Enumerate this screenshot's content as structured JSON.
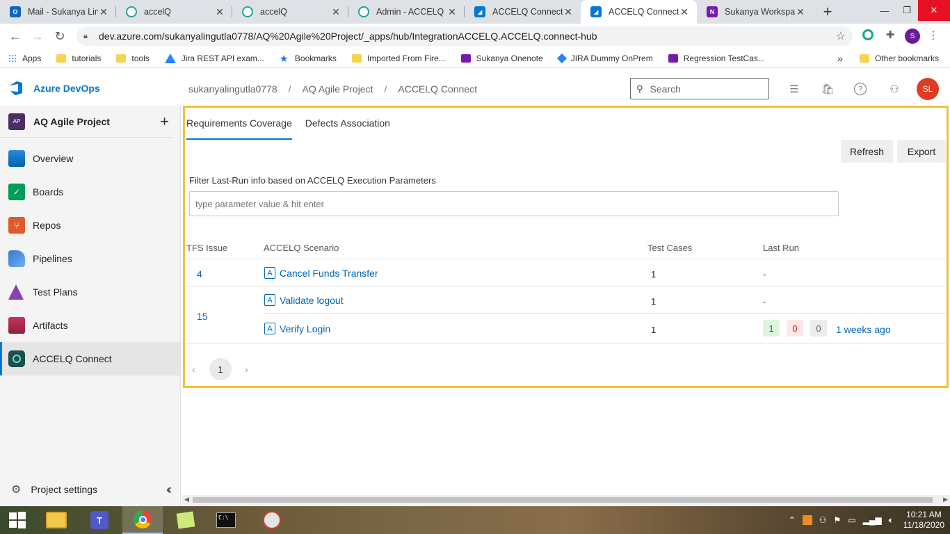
{
  "browser": {
    "tabs": [
      {
        "title": "Mail - Sukanya Ling",
        "icon": "outlook-icon",
        "color": "#0a64c8"
      },
      {
        "title": "accelQ",
        "icon": "accelq-icon",
        "color": "#1ea39b"
      },
      {
        "title": "accelQ",
        "icon": "accelq-icon",
        "color": "#1ea39b"
      },
      {
        "title": "Admin - ACCELQ",
        "icon": "accelq-icon",
        "color": "#1ea39b"
      },
      {
        "title": "ACCELQ Connect -",
        "icon": "azure-devops-icon",
        "color": "#0078d4"
      },
      {
        "title": "ACCELQ Connect -",
        "icon": "azure-devops-icon",
        "color": "#0078d4"
      },
      {
        "title": "Sukanya Workspac",
        "icon": "onenote-icon",
        "color": "#7719aa"
      }
    ],
    "url": "dev.azure.com/sukanyalingutla0778/AQ%20Agile%20Project/_apps/hub/IntegrationACCELQ.ACCELQ.connect-hub",
    "profile_initial": "S",
    "bookmarks": [
      {
        "label": "Apps",
        "icon": "apps-icon"
      },
      {
        "label": "tutorials",
        "icon": "folder-icon"
      },
      {
        "label": "tools",
        "icon": "folder-icon"
      },
      {
        "label": "Jira REST API exam...",
        "icon": "jira-icon"
      },
      {
        "label": "Bookmarks",
        "icon": "star-icon"
      },
      {
        "label": "Imported From Fire...",
        "icon": "folder-icon"
      },
      {
        "label": "Sukanya Onenote",
        "icon": "onenote-icon"
      },
      {
        "label": "JIRA Dummy OnPrem",
        "icon": "jira-icon"
      },
      {
        "label": "Regression TestCas...",
        "icon": "onenote-icon"
      }
    ],
    "overflow": "»",
    "other_bookmarks": "Other bookmarks"
  },
  "header": {
    "brand": "Azure DevOps",
    "breadcrumbs": [
      "sukanyalingutla0778",
      "AQ Agile Project",
      "ACCELQ Connect"
    ],
    "search_placeholder": "Search",
    "avatar": "SL"
  },
  "sidebar": {
    "project_badge": "AP",
    "project_name": "AQ Agile Project",
    "add": "+",
    "items": [
      {
        "label": "Overview",
        "icon": "overview-icon",
        "color": "#0078d4"
      },
      {
        "label": "Boards",
        "icon": "boards-icon",
        "color": "#009c5b"
      },
      {
        "label": "Repos",
        "icon": "repos-icon",
        "color": "#e05b2b"
      },
      {
        "label": "Pipelines",
        "icon": "pipelines-icon",
        "color": "#3a78c9"
      },
      {
        "label": "Test Plans",
        "icon": "test-plans-icon",
        "color": "#8a3fb5"
      },
      {
        "label": "Artifacts",
        "icon": "artifacts-icon",
        "color": "#c9345c"
      },
      {
        "label": "ACCELQ Connect",
        "icon": "accelq-connect-icon",
        "color": "#1b4f4c"
      }
    ],
    "settings": "Project settings"
  },
  "main": {
    "tabs": [
      "Requirements Coverage",
      "Defects Association"
    ],
    "refresh": "Refresh",
    "export": "Export",
    "filter_label": "Filter Last-Run info based on ACCELQ Execution Parameters",
    "filter_placeholder": "type parameter value & hit enter",
    "columns": [
      "TFS Issue",
      "ACCELQ Scenario",
      "Test Cases",
      "Last Run"
    ],
    "rows": [
      {
        "issue": "4",
        "scenario": "Cancel Funds Transfer",
        "test_cases": "1",
        "last_run": "-"
      },
      {
        "issue": "15",
        "scenario": "Validate logout",
        "test_cases": "1",
        "last_run": "-"
      },
      {
        "issue": "",
        "scenario": "Verify Login",
        "test_cases": "1",
        "passed": "1",
        "failed": "0",
        "other": "0",
        "last_run": "1 weeks ago"
      }
    ],
    "scenario_badge": "A",
    "page": "1"
  },
  "taskbar": {
    "time": "10:21 AM",
    "date": "11/18/2020"
  }
}
